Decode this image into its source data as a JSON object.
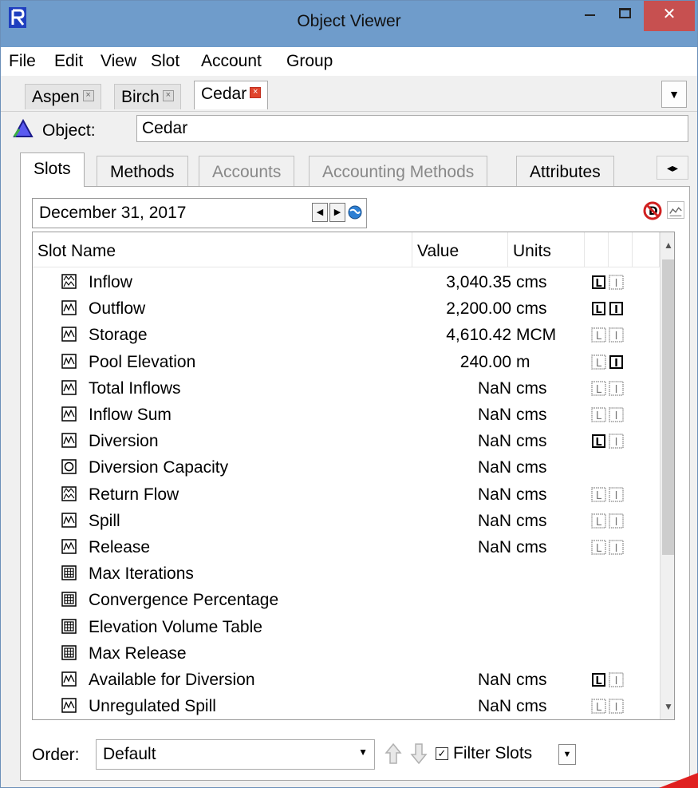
{
  "window": {
    "title": "Object Viewer",
    "close_glyph": "✕"
  },
  "menu": [
    "File",
    "Edit",
    "View",
    "Slot",
    "Account",
    "Group"
  ],
  "object_tabs": [
    {
      "label": "Aspen",
      "active": false
    },
    {
      "label": "Birch",
      "active": false
    },
    {
      "label": "Cedar",
      "active": true
    }
  ],
  "object": {
    "label": "Object:",
    "value": "Cedar"
  },
  "tabs": [
    {
      "label": "Slots",
      "state": "active"
    },
    {
      "label": "Methods",
      "state": "normal"
    },
    {
      "label": "Accounts",
      "state": "disabled"
    },
    {
      "label": "Accounting Methods",
      "state": "disabled"
    },
    {
      "label": "Attributes",
      "state": "normal"
    }
  ],
  "date": {
    "value": "December 31, 2017"
  },
  "table": {
    "columns": {
      "name": "Slot Name",
      "value": "Value",
      "units": "Units"
    },
    "rows": [
      {
        "name": "Inflow",
        "icon": "series-input-icon",
        "value": "3,040.35",
        "units": "cms",
        "flags": [
          "L-on",
          "I-off"
        ]
      },
      {
        "name": "Outflow",
        "icon": "series-icon",
        "value": "2,200.00",
        "units": "cms",
        "flags": [
          "L-on",
          "I-on"
        ]
      },
      {
        "name": "Storage",
        "icon": "series-icon",
        "value": "4,610.42",
        "units": "MCM",
        "flags": [
          "L-off",
          "I-off"
        ]
      },
      {
        "name": "Pool Elevation",
        "icon": "series-icon",
        "value": "240.00",
        "units": "m",
        "flags": [
          "L-off",
          "I-on"
        ]
      },
      {
        "name": "Total Inflows",
        "icon": "series-icon",
        "value": "NaN",
        "units": "cms",
        "flags": [
          "L-off",
          "I-off"
        ]
      },
      {
        "name": "Inflow Sum",
        "icon": "series-icon",
        "value": "NaN",
        "units": "cms",
        "flags": [
          "L-off",
          "I-off"
        ]
      },
      {
        "name": "Diversion",
        "icon": "series-icon",
        "value": "NaN",
        "units": "cms",
        "flags": [
          "L-on",
          "I-off"
        ]
      },
      {
        "name": "Diversion Capacity",
        "icon": "scalar-icon",
        "value": "NaN",
        "units": "cms",
        "flags": []
      },
      {
        "name": "Return Flow",
        "icon": "series-input-icon",
        "value": "NaN",
        "units": "cms",
        "flags": [
          "L-off",
          "I-off"
        ]
      },
      {
        "name": "Spill",
        "icon": "series-icon",
        "value": "NaN",
        "units": "cms",
        "flags": [
          "L-off",
          "I-off"
        ]
      },
      {
        "name": "Release",
        "icon": "series-icon",
        "value": "NaN",
        "units": "cms",
        "flags": [
          "L-off",
          "I-off"
        ]
      },
      {
        "name": "Max Iterations",
        "icon": "table-icon",
        "value": "",
        "units": "",
        "flags": []
      },
      {
        "name": "Convergence Percentage",
        "icon": "table-icon",
        "value": "",
        "units": "",
        "flags": []
      },
      {
        "name": "Elevation Volume Table",
        "icon": "table-icon",
        "value": "",
        "units": "",
        "flags": []
      },
      {
        "name": "Max Release",
        "icon": "table-icon",
        "value": "",
        "units": "",
        "flags": []
      },
      {
        "name": "Available for Diversion",
        "icon": "series-icon",
        "value": "NaN",
        "units": "cms",
        "flags": [
          "L-on",
          "I-off"
        ]
      },
      {
        "name": "Unregulated Spill",
        "icon": "series-icon",
        "value": "NaN",
        "units": "cms",
        "flags": [
          "L-off",
          "I-off"
        ]
      }
    ]
  },
  "bottom": {
    "order_label": "Order:",
    "order_value": "Default",
    "filter_label": "Filter Slots",
    "filter_checked": true
  },
  "colors": {
    "titlebar": "#6f9ccb",
    "close": "#c75050",
    "tab_close_active": "#e0442c"
  }
}
